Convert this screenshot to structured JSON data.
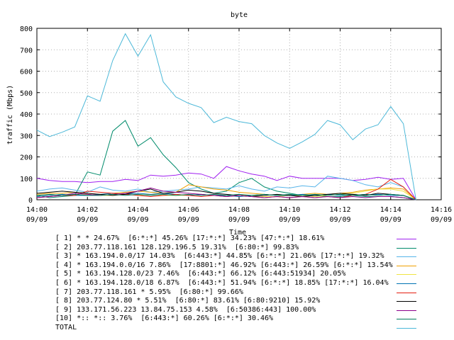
{
  "chart_data": {
    "type": "line",
    "title": "byte",
    "xlabel": "Time",
    "ylabel": "traffic (Mbps)",
    "ylim": [
      0,
      800
    ],
    "yticks": [
      "0",
      "100",
      "200",
      "300",
      "400",
      "500",
      "600",
      "700",
      "800"
    ],
    "xlim": [
      "14:00",
      "14:16"
    ],
    "xticks": [
      {
        "time": "14:00",
        "date": "09/09"
      },
      {
        "time": "14:02",
        "date": "09/09"
      },
      {
        "time": "14:04",
        "date": "09/09"
      },
      {
        "time": "14:06",
        "date": "09/09"
      },
      {
        "time": "14:08",
        "date": "09/09"
      },
      {
        "time": "14:10",
        "date": "09/09"
      },
      {
        "time": "14:12",
        "date": "09/09"
      },
      {
        "time": "14:14",
        "date": "09/09"
      },
      {
        "time": "14:16",
        "date": "09/09"
      }
    ],
    "x": [
      "14:00",
      "14:00:30",
      "14:01",
      "14:01:30",
      "14:02",
      "14:02:30",
      "14:03",
      "14:03:30",
      "14:04",
      "14:04:30",
      "14:05",
      "14:05:30",
      "14:06",
      "14:06:30",
      "14:07",
      "14:07:30",
      "14:08",
      "14:08:30",
      "14:09",
      "14:09:30",
      "14:10",
      "14:10:30",
      "14:11",
      "14:11:30",
      "14:12",
      "14:12:30",
      "14:13",
      "14:13:30",
      "14:14",
      "14:14:30",
      "14:15"
    ],
    "grid": true,
    "legend_position": "bottom",
    "series": [
      {
        "name": "[ 1] * * 24.67%  [6:*:*] 45.26% [17:*:*] 34.23% [47:*:*] 18.61%",
        "color": "#a020f0",
        "values": [
          100,
          90,
          85,
          85,
          80,
          85,
          85,
          95,
          90,
          115,
          110,
          115,
          125,
          120,
          100,
          155,
          135,
          120,
          110,
          90,
          110,
          100,
          100,
          100,
          100,
          90,
          95,
          105,
          95,
          100,
          0
        ]
      },
      {
        "name": "[ 2] 203.77.118.161 128.129.196.5 19.31%  [6:80:*] 99.83%",
        "color": "#008b6b",
        "values": [
          20,
          10,
          15,
          20,
          130,
          115,
          320,
          370,
          250,
          290,
          210,
          150,
          80,
          50,
          30,
          40,
          80,
          100,
          60,
          40,
          30,
          20,
          20,
          15,
          15,
          20,
          15,
          15,
          15,
          10,
          0
        ]
      },
      {
        "name": "[ 3] * 163.194.0.0/17 14.03%  [6:443:*] 44.85% [6:*:*] 21.06% [17:*:*] 19.32%",
        "color": "#56b4e9",
        "values": [
          40,
          50,
          55,
          45,
          35,
          60,
          45,
          40,
          50,
          35,
          40,
          45,
          50,
          60,
          55,
          50,
          65,
          50,
          40,
          60,
          55,
          65,
          60,
          110,
          100,
          90,
          70,
          60,
          80,
          60,
          0
        ]
      },
      {
        "name": "[ 4] * 163.194.0.0/16 7.86%  [17:8801:*] 46.92% [6:443:*] 26.59% [6:*:*] 13.54%",
        "color": "#f0a000",
        "values": [
          25,
          30,
          30,
          35,
          30,
          25,
          30,
          35,
          40,
          35,
          30,
          35,
          70,
          60,
          50,
          45,
          35,
          30,
          25,
          20,
          20,
          25,
          30,
          25,
          30,
          35,
          45,
          50,
          55,
          50,
          0
        ]
      },
      {
        "name": "[ 5] * 163.194.128.0/23 7.46%  [6:443:*] 66.12% [6:443:51934] 20.05%",
        "color": "#f0e442",
        "values": [
          15,
          20,
          25,
          20,
          25,
          20,
          20,
          25,
          20,
          25,
          20,
          20,
          20,
          25,
          20,
          15,
          20,
          20,
          15,
          15,
          20,
          20,
          15,
          20,
          25,
          30,
          40,
          50,
          50,
          40,
          0
        ]
      },
      {
        "name": "[ 6] * 163.194.128.0/18 6.87%  [6:443:*] 51.94% [6:*:*] 18.85% [17:*:*] 16.04%",
        "color": "#0072b2",
        "values": [
          15,
          20,
          25,
          20,
          20,
          25,
          30,
          25,
          30,
          25,
          30,
          25,
          20,
          25,
          20,
          20,
          15,
          20,
          25,
          20,
          20,
          25,
          20,
          25,
          20,
          25,
          20,
          25,
          20,
          20,
          0
        ]
      },
      {
        "name": "[ 7] 203.77.118.161 * 5.95%  [6:80:*] 99.66%",
        "color": "#e51e10",
        "values": [
          10,
          15,
          20,
          20,
          40,
          35,
          30,
          25,
          20,
          15,
          20,
          25,
          20,
          15,
          20,
          15,
          20,
          15,
          10,
          15,
          10,
          15,
          10,
          15,
          10,
          20,
          25,
          50,
          95,
          60,
          0
        ]
      },
      {
        "name": "[ 8] 203.77.124.80 * 5.51%  [6:80:*] 83.61% [6:80:9210] 15.92%",
        "color": "#000000",
        "values": [
          30,
          35,
          40,
          35,
          30,
          25,
          20,
          25,
          40,
          50,
          30,
          35,
          45,
          40,
          30,
          25,
          20,
          15,
          20,
          25,
          20,
          15,
          20,
          25,
          30,
          25,
          20,
          30,
          25,
          20,
          0
        ]
      },
      {
        "name": "[ 9] 133.171.56.223 13.84.75.153 4.58%  [6:50386:443] 100.00%",
        "color": "#8b008b",
        "values": [
          10,
          15,
          20,
          30,
          25,
          20,
          25,
          30,
          40,
          55,
          40,
          35,
          30,
          25,
          20,
          15,
          20,
          15,
          10,
          15,
          10,
          15,
          10,
          15,
          10,
          15,
          10,
          15,
          15,
          10,
          0
        ]
      },
      {
        "name": "[10] *:: *:: 3.76%  [6:443:*] 60.26% [6:*:*] 30.46%",
        "color": "#007a5a",
        "values": [
          20,
          25,
          20,
          25,
          20,
          20,
          25,
          20,
          25,
          20,
          25,
          20,
          25,
          20,
          25,
          20,
          25,
          20,
          25,
          20,
          25,
          20,
          25,
          20,
          25,
          20,
          25,
          20,
          25,
          20,
          0
        ]
      },
      {
        "name": "TOTAL",
        "color": "#4cb8d8",
        "values": [
          325,
          295,
          315,
          340,
          485,
          460,
          650,
          775,
          670,
          770,
          550,
          480,
          450,
          430,
          360,
          385,
          365,
          355,
          300,
          265,
          240,
          270,
          305,
          370,
          350,
          280,
          330,
          350,
          435,
          355,
          0
        ]
      }
    ]
  }
}
